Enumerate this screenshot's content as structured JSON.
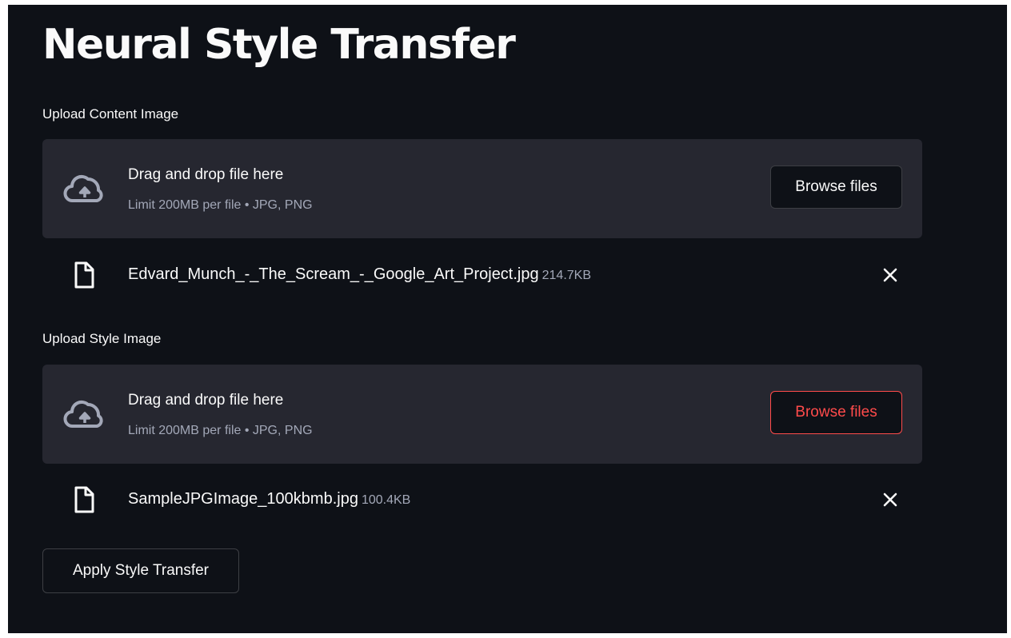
{
  "page_title": "Neural Style Transfer",
  "content_uploader": {
    "label": "Upload Content Image",
    "dropzone_title": "Drag and drop file here",
    "dropzone_limit": "Limit 200MB per file • JPG, PNG",
    "browse_label": "Browse files",
    "file": {
      "name": "Edvard_Munch_-_The_Scream_-_Google_Art_Project.jpg",
      "size": "214.7KB"
    }
  },
  "style_uploader": {
    "label": "Upload Style Image",
    "dropzone_title": "Drag and drop file here",
    "dropzone_limit": "Limit 200MB per file • JPG, PNG",
    "browse_label": "Browse files",
    "file": {
      "name": "SampleJPGImage_100kbmb.jpg",
      "size": "100.4KB"
    }
  },
  "apply_button_label": "Apply Style Transfer",
  "icons": {
    "upload": "cloud-upload-icon",
    "file": "file-icon",
    "remove": "close-icon"
  },
  "colors": {
    "background": "#0e1117",
    "dropzone": "#262730",
    "text": "#fafafa",
    "muted_text": "#a3a8b8",
    "accent": "#ff4b4b"
  }
}
